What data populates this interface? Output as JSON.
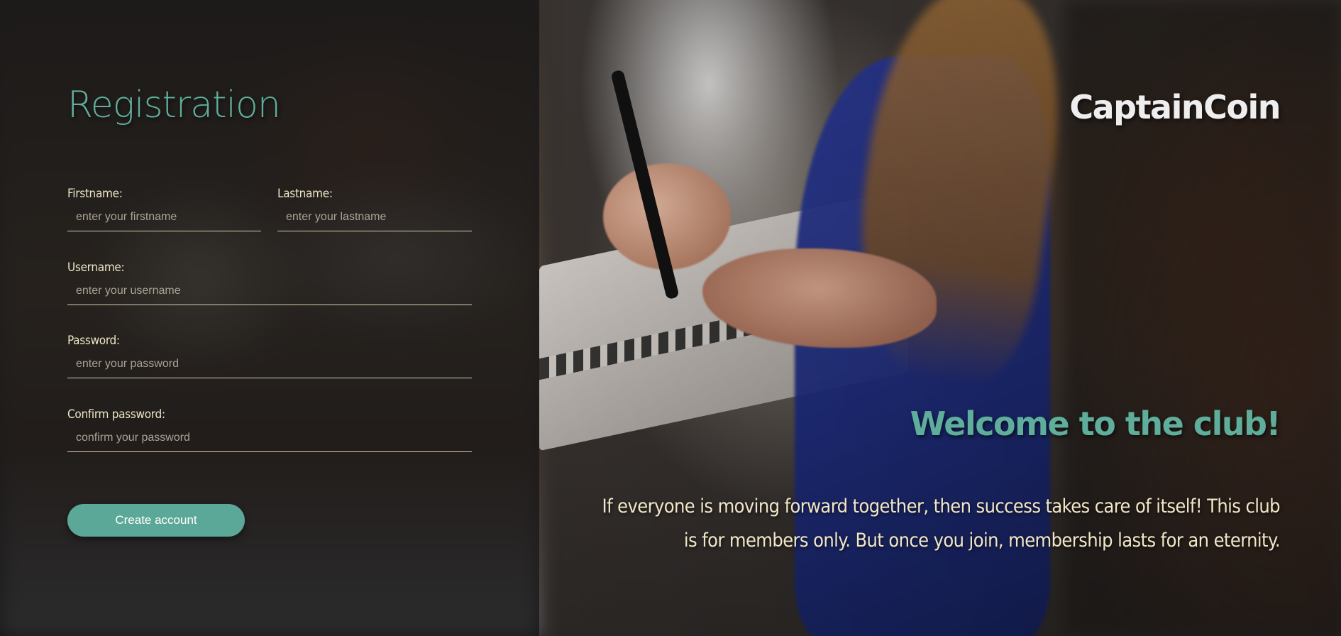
{
  "form": {
    "title": "Registration",
    "firstname": {
      "label": "Firstname:",
      "placeholder": "enter your firstname"
    },
    "lastname": {
      "label": "Lastname:",
      "placeholder": "enter your lastname"
    },
    "username": {
      "label": "Username:",
      "placeholder": "enter your username"
    },
    "password": {
      "label": "Password:",
      "placeholder": "enter your password"
    },
    "confirm": {
      "label": "Confirm password:",
      "placeholder": "confirm your password"
    },
    "submit_label": "Create account"
  },
  "hero": {
    "brand": "CaptainCoin",
    "welcome": "Welcome to the club!",
    "tagline": "If everyone is moving forward together, then success takes care of itself! This club is for members only. But once you join, membership lasts for an eternity."
  },
  "colors": {
    "accent": "#5fae9c",
    "button": "#5ca898",
    "text_cream": "#f1e6c8"
  }
}
